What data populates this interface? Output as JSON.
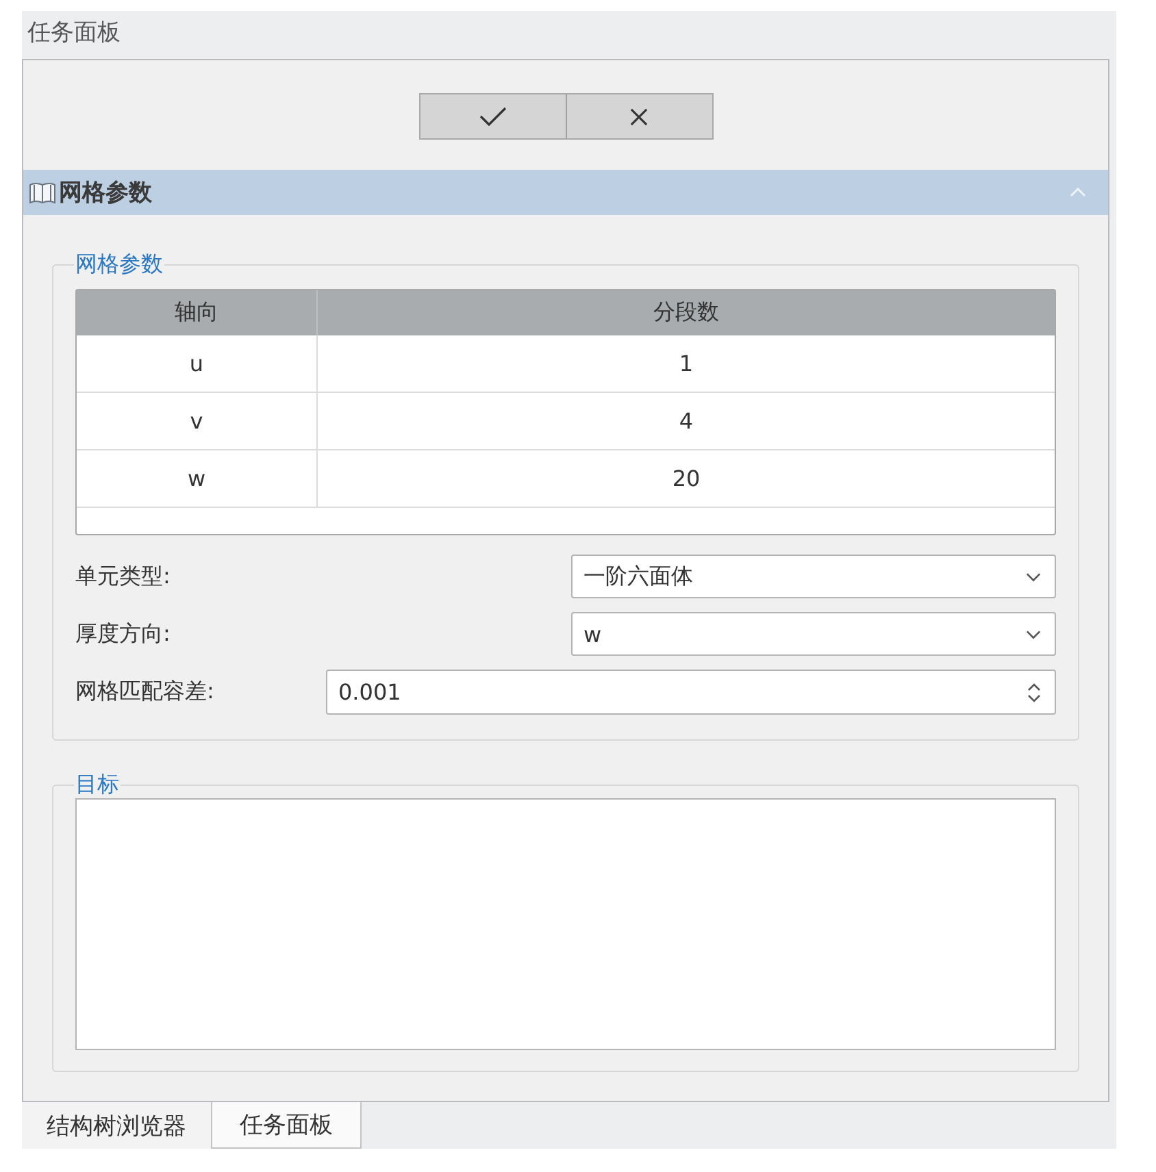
{
  "panel": {
    "title": "任务面板"
  },
  "toolbar": {
    "buttons": [
      {
        "kind": "confirm"
      },
      {
        "kind": "cancel"
      }
    ]
  },
  "section": {
    "title": "网格参数",
    "expanded": true
  },
  "mesh_group": {
    "title": "网格参数",
    "table": {
      "columns": [
        "轴向",
        "分段数"
      ],
      "rows": [
        [
          "u",
          "1"
        ],
        [
          "v",
          "4"
        ],
        [
          "w",
          "20"
        ]
      ]
    },
    "fields": [
      {
        "kind": "dropdown",
        "label": "单元类型:",
        "value": "一阶六面体"
      },
      {
        "kind": "dropdown",
        "label": "厚度方向:",
        "value": "w"
      },
      {
        "kind": "spinbox",
        "label": "网格匹配容差:",
        "value": "0.001"
      }
    ]
  },
  "target_group": {
    "title": "目标"
  },
  "bottom_tabs": [
    {
      "label": "结构树浏览器",
      "selected": false
    },
    {
      "label": "任务面板",
      "selected": true
    }
  ]
}
